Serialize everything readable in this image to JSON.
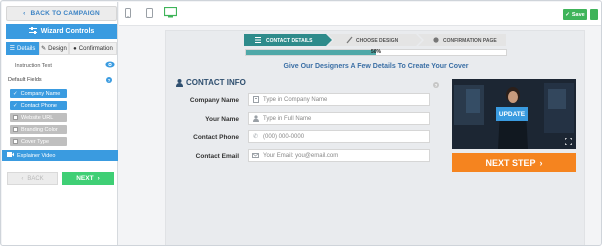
{
  "sidebar": {
    "back_label": "BACK TO CAMPAIGN",
    "wizard_title": "Wizard Controls",
    "tabs": [
      {
        "label": "Details",
        "active": true
      },
      {
        "label": "Design",
        "active": false
      },
      {
        "label": "Confirmation",
        "active": false
      }
    ],
    "instruction_label": "Instruction Text",
    "default_fields_label": "Default Fields",
    "fields": [
      {
        "label": "Company Name",
        "enabled": true
      },
      {
        "label": "Contact Phone",
        "enabled": true
      },
      {
        "label": "Website URL",
        "enabled": false
      },
      {
        "label": "Branding Color",
        "enabled": false
      },
      {
        "label": "Cover Type",
        "enabled": false
      }
    ],
    "explainer_label": "Explainer Video",
    "back_btn": "BACK",
    "next_btn": "NEXT"
  },
  "topbar": {
    "save_label": "Save"
  },
  "wizard": {
    "steps": [
      "CONTACT DETAILS",
      "CHOOSE DESIGN",
      "CONFIRMATION PAGE"
    ],
    "progress_percent": 50,
    "progress_label": "50%",
    "headline": "Give Our Designers A Few Details To Create Your Cover",
    "contact_title": "CONTACT INFO",
    "rows": [
      {
        "label": "Company Name",
        "placeholder": "Type in Company Name"
      },
      {
        "label": "Your Name",
        "placeholder": "Type in Full Name"
      },
      {
        "label": "Contact Phone",
        "placeholder": "(000) 000-0000"
      },
      {
        "label": "Contact Email",
        "placeholder": "Your Email: you@email.com"
      }
    ],
    "update_label": "UPDATE",
    "next_step_label": "NEXT STEP"
  },
  "colors": {
    "accent": "#3a9be0",
    "success": "#3fcf75",
    "cta": "#f5841f",
    "step_active": "#2e8b8b"
  }
}
